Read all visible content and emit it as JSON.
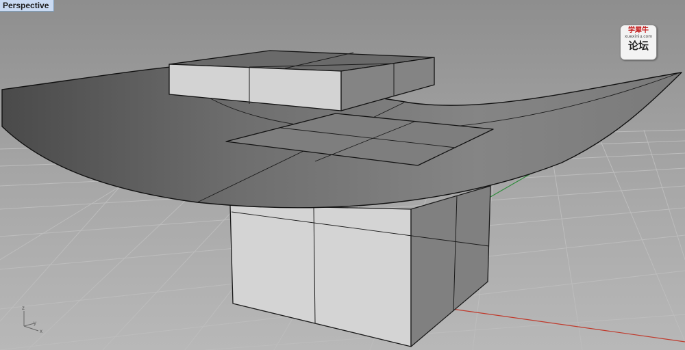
{
  "viewport": {
    "tab_label": "Perspective"
  },
  "axis_widget": {
    "z": "z",
    "y": "y",
    "x": "x"
  },
  "watermark": {
    "top_text": "学犀牛",
    "url_text": "xuexiniu.com",
    "main_text": "论坛"
  },
  "colors": {
    "background": "#a9a9a9",
    "grid_line": "#bdbdbd",
    "x_axis": "#c0392b",
    "y_axis": "#2e8b3a",
    "tab_background": "#c9daf2"
  }
}
